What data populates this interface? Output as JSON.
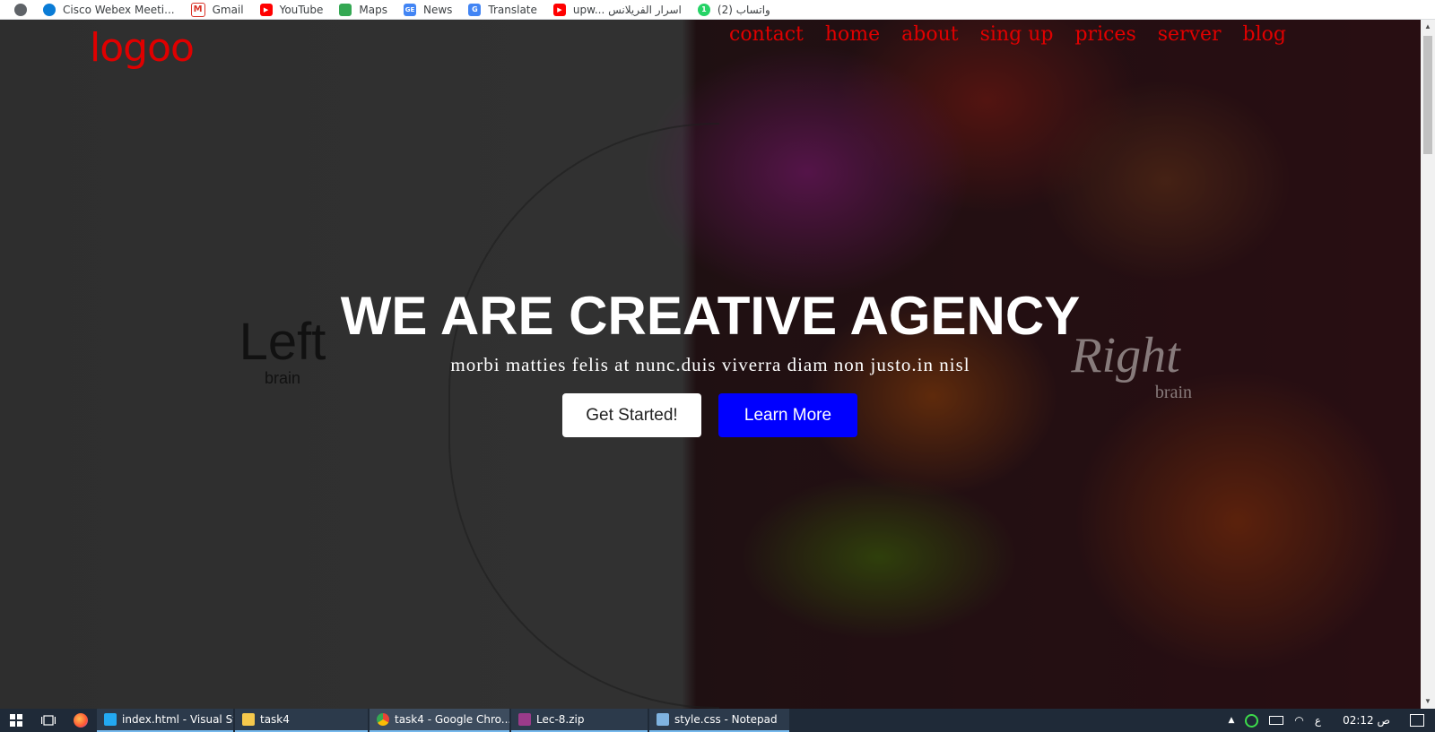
{
  "bookmarks": [
    {
      "label": "Cisco Webex Meeti...",
      "icon": "webex-icon",
      "color": "#0a7cd6"
    },
    {
      "label": "Gmail",
      "icon": "gmail-icon",
      "color": "#d93025"
    },
    {
      "label": "YouTube",
      "icon": "youtube-icon",
      "color": "#ff0000"
    },
    {
      "label": "Maps",
      "icon": "maps-icon",
      "color": "#34a853"
    },
    {
      "label": "News",
      "icon": "news-icon",
      "color": "#4285f4"
    },
    {
      "label": "Translate",
      "icon": "translate-icon",
      "color": "#4285f4"
    },
    {
      "label": "upw... اسرار الفريلانس",
      "icon": "youtube-icon",
      "color": "#ff0000"
    },
    {
      "label": "واتساب (2)",
      "icon": "whatsapp-icon",
      "color": "#25d366"
    }
  ],
  "site": {
    "logo": "logoo",
    "nav": [
      "contact",
      "home",
      "about",
      "sing up",
      "prices",
      "server",
      "blog"
    ],
    "headline": "WE ARE CREATIVE AGENCY",
    "subline": "morbi matties felis at nunc.duis viverra diam non justo.in nisl",
    "btn_start": "Get Started!",
    "btn_learn": "Learn More",
    "art_left_title": "Left",
    "art_left_sub": "brain",
    "art_right_title": "Right",
    "art_right_sub": "brain",
    "accent_color": "#e00000",
    "learn_color": "#0000ff"
  },
  "taskbar": {
    "apps": [
      {
        "label": "index.html - Visual St...",
        "icon": "vscode-icon",
        "color": "#23a9f2"
      },
      {
        "label": "task4",
        "icon": "folder-icon",
        "color": "#f5c84c"
      },
      {
        "label": "task4 - Google Chro...",
        "icon": "chrome-icon",
        "color": "#4285f4"
      },
      {
        "label": "Lec-8.zip",
        "icon": "winrar-icon",
        "color": "#9b3b8a"
      },
      {
        "label": "style.css - Notepad",
        "icon": "notepad-icon",
        "color": "#7fb3e0"
      }
    ],
    "lang": "ع",
    "time": "02:12 ص"
  }
}
